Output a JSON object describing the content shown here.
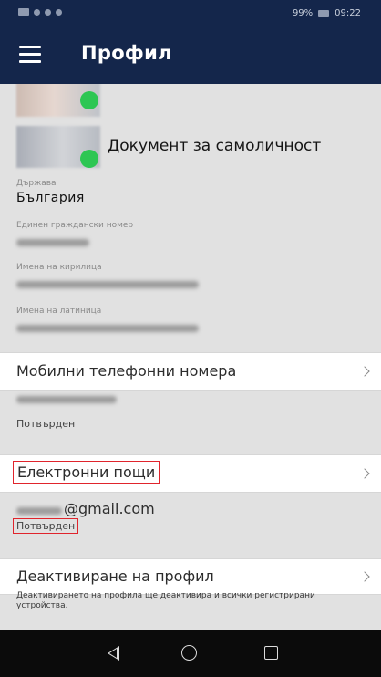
{
  "status_bar": {
    "icons": [
      "sim-icon",
      "wifi-icon",
      "signal-icon",
      "notification-icon"
    ],
    "battery": "99%",
    "time": "09:22"
  },
  "app_bar": {
    "title": "Профил",
    "menu_icon": "hamburger-menu-icon"
  },
  "profile": {
    "id_document_label": "Документ за самоличност",
    "fields": [
      {
        "label": "Държава",
        "value": "България"
      },
      {
        "label": "Единен граждански номер",
        "value": ""
      },
      {
        "label": "Имена на кирилица",
        "value": ""
      },
      {
        "label": "Имена на латиница",
        "value": ""
      }
    ]
  },
  "phones": {
    "title": "Мобилни телефонни номера",
    "status": "Потвърден"
  },
  "emails": {
    "title": "Електронни пощи",
    "email_suffix": "@gmail.com",
    "status": "Потвърден"
  },
  "deactivate": {
    "title": "Деактивиране на профил",
    "note": "Деактивирането на профила ще деактивира и всички регистрирани устройства."
  },
  "colors": {
    "header": "#14264b",
    "verified": "#2dc653",
    "highlight": "#e0242c"
  },
  "nav_bar": {
    "icons": [
      "back-icon",
      "home-icon",
      "recent-apps-icon"
    ]
  }
}
